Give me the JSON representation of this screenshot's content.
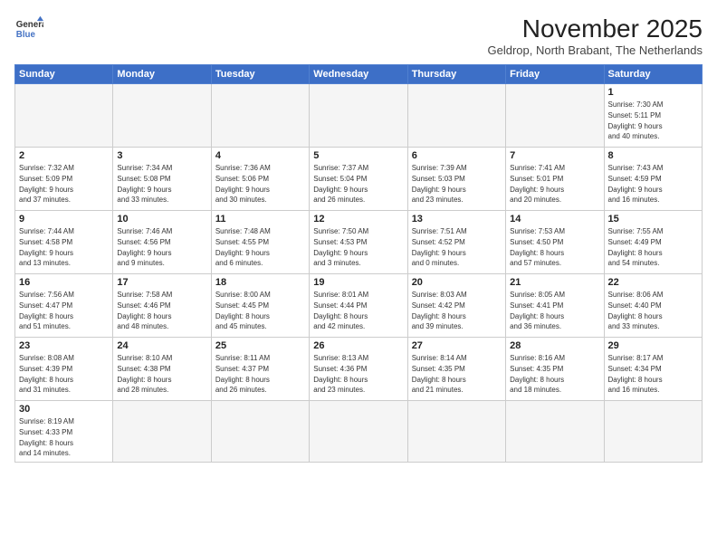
{
  "header": {
    "logo_line1": "General",
    "logo_line2": "Blue",
    "month_title": "November 2025",
    "subtitle": "Geldrop, North Brabant, The Netherlands"
  },
  "weekdays": [
    "Sunday",
    "Monday",
    "Tuesday",
    "Wednesday",
    "Thursday",
    "Friday",
    "Saturday"
  ],
  "days": {
    "d1": {
      "num": "1",
      "info": "Sunrise: 7:30 AM\nSunset: 5:11 PM\nDaylight: 9 hours\nand 40 minutes."
    },
    "d2": {
      "num": "2",
      "info": "Sunrise: 7:32 AM\nSunset: 5:09 PM\nDaylight: 9 hours\nand 37 minutes."
    },
    "d3": {
      "num": "3",
      "info": "Sunrise: 7:34 AM\nSunset: 5:08 PM\nDaylight: 9 hours\nand 33 minutes."
    },
    "d4": {
      "num": "4",
      "info": "Sunrise: 7:36 AM\nSunset: 5:06 PM\nDaylight: 9 hours\nand 30 minutes."
    },
    "d5": {
      "num": "5",
      "info": "Sunrise: 7:37 AM\nSunset: 5:04 PM\nDaylight: 9 hours\nand 26 minutes."
    },
    "d6": {
      "num": "6",
      "info": "Sunrise: 7:39 AM\nSunset: 5:03 PM\nDaylight: 9 hours\nand 23 minutes."
    },
    "d7": {
      "num": "7",
      "info": "Sunrise: 7:41 AM\nSunset: 5:01 PM\nDaylight: 9 hours\nand 20 minutes."
    },
    "d8": {
      "num": "8",
      "info": "Sunrise: 7:43 AM\nSunset: 4:59 PM\nDaylight: 9 hours\nand 16 minutes."
    },
    "d9": {
      "num": "9",
      "info": "Sunrise: 7:44 AM\nSunset: 4:58 PM\nDaylight: 9 hours\nand 13 minutes."
    },
    "d10": {
      "num": "10",
      "info": "Sunrise: 7:46 AM\nSunset: 4:56 PM\nDaylight: 9 hours\nand 9 minutes."
    },
    "d11": {
      "num": "11",
      "info": "Sunrise: 7:48 AM\nSunset: 4:55 PM\nDaylight: 9 hours\nand 6 minutes."
    },
    "d12": {
      "num": "12",
      "info": "Sunrise: 7:50 AM\nSunset: 4:53 PM\nDaylight: 9 hours\nand 3 minutes."
    },
    "d13": {
      "num": "13",
      "info": "Sunrise: 7:51 AM\nSunset: 4:52 PM\nDaylight: 9 hours\nand 0 minutes."
    },
    "d14": {
      "num": "14",
      "info": "Sunrise: 7:53 AM\nSunset: 4:50 PM\nDaylight: 8 hours\nand 57 minutes."
    },
    "d15": {
      "num": "15",
      "info": "Sunrise: 7:55 AM\nSunset: 4:49 PM\nDaylight: 8 hours\nand 54 minutes."
    },
    "d16": {
      "num": "16",
      "info": "Sunrise: 7:56 AM\nSunset: 4:47 PM\nDaylight: 8 hours\nand 51 minutes."
    },
    "d17": {
      "num": "17",
      "info": "Sunrise: 7:58 AM\nSunset: 4:46 PM\nDaylight: 8 hours\nand 48 minutes."
    },
    "d18": {
      "num": "18",
      "info": "Sunrise: 8:00 AM\nSunset: 4:45 PM\nDaylight: 8 hours\nand 45 minutes."
    },
    "d19": {
      "num": "19",
      "info": "Sunrise: 8:01 AM\nSunset: 4:44 PM\nDaylight: 8 hours\nand 42 minutes."
    },
    "d20": {
      "num": "20",
      "info": "Sunrise: 8:03 AM\nSunset: 4:42 PM\nDaylight: 8 hours\nand 39 minutes."
    },
    "d21": {
      "num": "21",
      "info": "Sunrise: 8:05 AM\nSunset: 4:41 PM\nDaylight: 8 hours\nand 36 minutes."
    },
    "d22": {
      "num": "22",
      "info": "Sunrise: 8:06 AM\nSunset: 4:40 PM\nDaylight: 8 hours\nand 33 minutes."
    },
    "d23": {
      "num": "23",
      "info": "Sunrise: 8:08 AM\nSunset: 4:39 PM\nDaylight: 8 hours\nand 31 minutes."
    },
    "d24": {
      "num": "24",
      "info": "Sunrise: 8:10 AM\nSunset: 4:38 PM\nDaylight: 8 hours\nand 28 minutes."
    },
    "d25": {
      "num": "25",
      "info": "Sunrise: 8:11 AM\nSunset: 4:37 PM\nDaylight: 8 hours\nand 26 minutes."
    },
    "d26": {
      "num": "26",
      "info": "Sunrise: 8:13 AM\nSunset: 4:36 PM\nDaylight: 8 hours\nand 23 minutes."
    },
    "d27": {
      "num": "27",
      "info": "Sunrise: 8:14 AM\nSunset: 4:35 PM\nDaylight: 8 hours\nand 21 minutes."
    },
    "d28": {
      "num": "28",
      "info": "Sunrise: 8:16 AM\nSunset: 4:35 PM\nDaylight: 8 hours\nand 18 minutes."
    },
    "d29": {
      "num": "29",
      "info": "Sunrise: 8:17 AM\nSunset: 4:34 PM\nDaylight: 8 hours\nand 16 minutes."
    },
    "d30": {
      "num": "30",
      "info": "Sunrise: 8:19 AM\nSunset: 4:33 PM\nDaylight: 8 hours\nand 14 minutes."
    }
  }
}
